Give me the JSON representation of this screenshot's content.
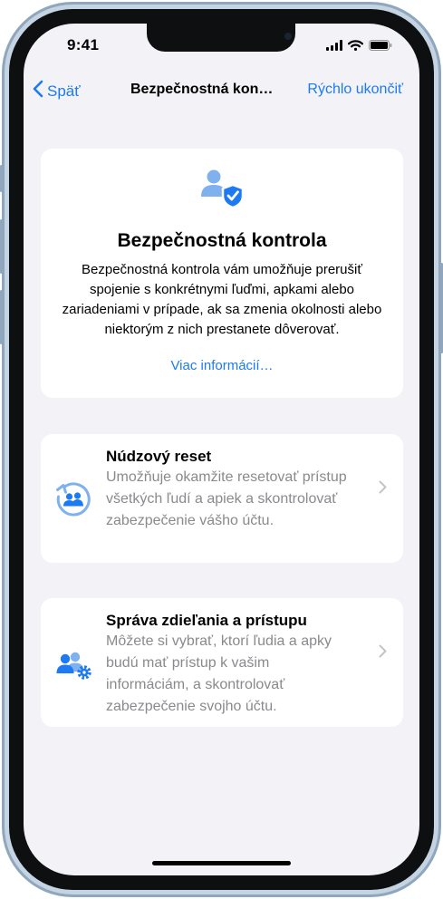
{
  "status": {
    "time": "9:41"
  },
  "nav": {
    "back_label": "Späť",
    "title": "Bezpečnostná kon…",
    "quick_exit": "Rýchlo ukončiť"
  },
  "hero": {
    "title": "Bezpečnostná kontrola",
    "body": "Bezpečnostná kontrola vám umožňuje prerušiť spojenie s konkrétnymi ľuďmi, apkami alebo zariadeniami v prípade, ak sa zmenia okolnosti alebo niektorým z nich prestanete dôverovať.",
    "link": "Viac informácií…"
  },
  "options": [
    {
      "title": "Núdzový reset",
      "description": "Umožňuje okamžite resetovať prístup všetkých ľudí a apiek a skontrolovať zabezpečenie vášho účtu."
    },
    {
      "title": "Správa zdieľania a prístupu",
      "description": "Môžete si vybrať, ktorí ľudia a apky budú mať prístup k vašim informáciám, a skontrolovať zabezpečenie svojho účtu."
    }
  ],
  "icons": {
    "signal": "cellular-signal-icon",
    "wifi": "wifi-icon",
    "battery": "battery-icon",
    "back": "chevron-left-icon",
    "hero": "person-shield-icon",
    "emergency": "emergency-reset-icon",
    "sharing": "people-gear-icon",
    "chevron": "chevron-right-icon"
  },
  "colors": {
    "accent": "#1d7af3",
    "icon_light": "#7fb1ee",
    "background": "#f2f2f7",
    "secondary_text": "#8a8a8e"
  }
}
